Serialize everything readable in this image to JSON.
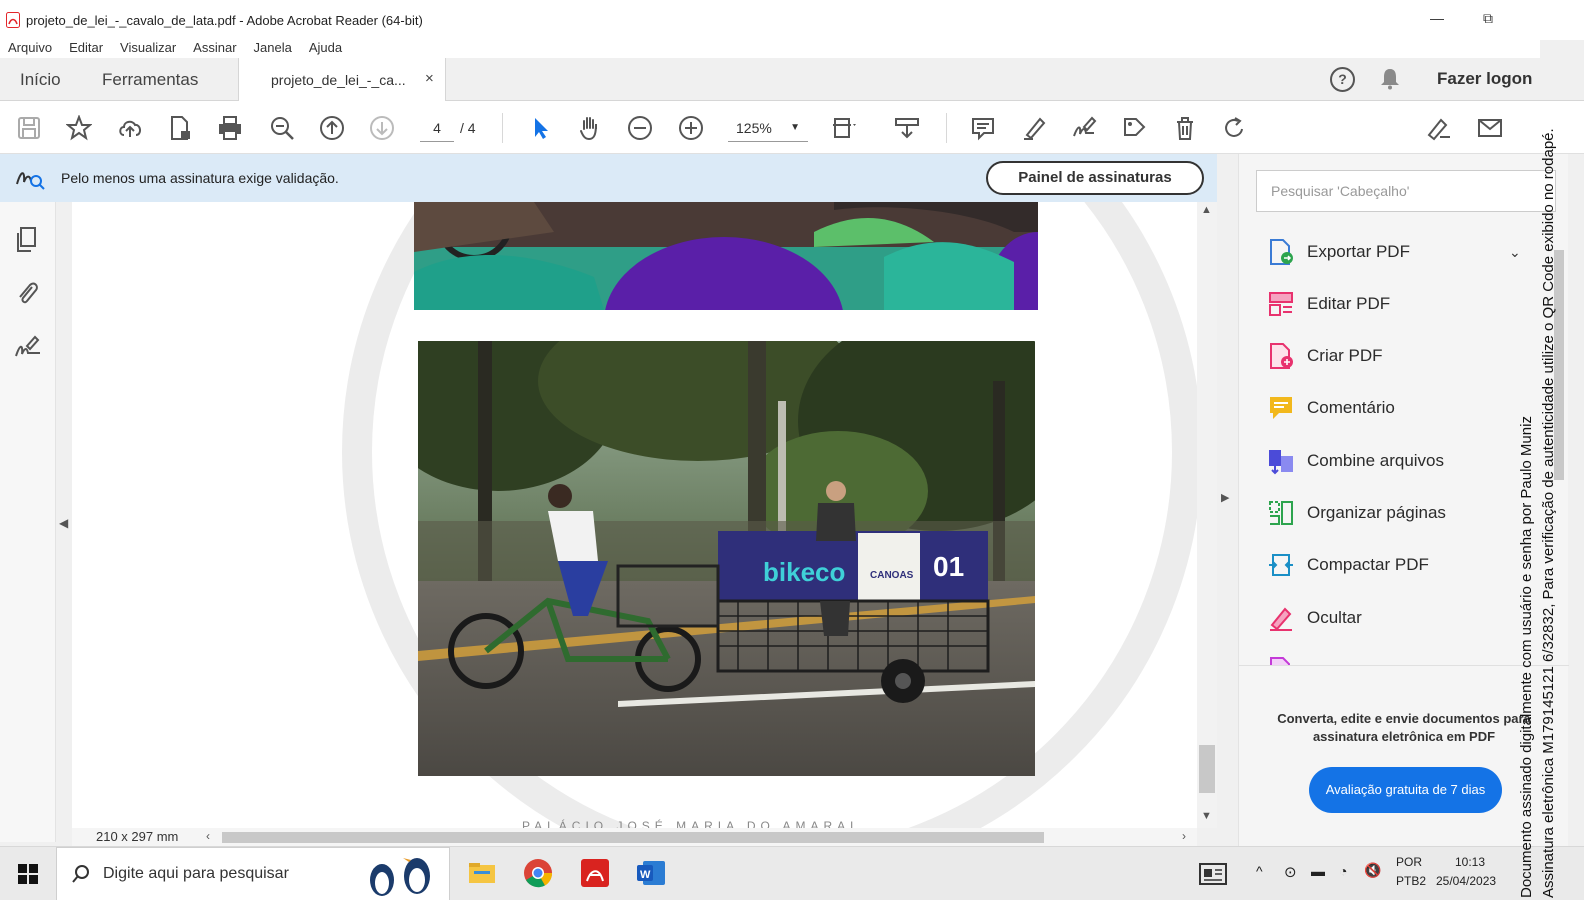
{
  "window": {
    "title": "projeto_de_lei_-_cavalo_de_lata.pdf - Adobe Acrobat Reader (64-bit)",
    "min": "—",
    "restore": "⧉"
  },
  "menu": [
    "Arquivo",
    "Editar",
    "Visualizar",
    "Assinar",
    "Janela",
    "Ajuda"
  ],
  "tabs": {
    "home": "Início",
    "tools": "Ferramentas",
    "doc": "projeto_de_lei_-_ca...",
    "close": "×",
    "logout": "Fazer logon"
  },
  "toolbar": {
    "page_current": "4",
    "page_total": "/ 4",
    "zoom": "125%"
  },
  "signature_bar": {
    "message": "Pelo menos uma assinatura exige validação.",
    "button": "Painel de assinaturas"
  },
  "document": {
    "footer": "PALÁCIO JOSÉ MARIA DO AMARAL",
    "size": "210 x 297 mm",
    "banner_text": "bikeco",
    "banner_city": "CANOAS",
    "banner_number": "01"
  },
  "right_panel": {
    "search_placeholder": "Pesquisar 'Cabeçalho'",
    "tools": [
      {
        "label": "Exportar PDF",
        "icon": "export-pdf-icon",
        "color": "#3a7bd5"
      },
      {
        "label": "Editar PDF",
        "icon": "edit-pdf-icon",
        "color": "#e8326e"
      },
      {
        "label": "Criar PDF",
        "icon": "create-pdf-icon",
        "color": "#e8326e"
      },
      {
        "label": "Comentário",
        "icon": "comment-icon",
        "color": "#f2b81c"
      },
      {
        "label": "Combine arquivos",
        "icon": "combine-icon",
        "color": "#4b4bd8"
      },
      {
        "label": "Organizar páginas",
        "icon": "organize-icon",
        "color": "#2da44e"
      },
      {
        "label": "Compactar PDF",
        "icon": "compress-icon",
        "color": "#1a8fc6"
      },
      {
        "label": "Ocultar",
        "icon": "redact-icon",
        "color": "#e8326e"
      }
    ],
    "promo": "Converta, edite e envie documentos para assinatura eletrônica em PDF",
    "trial_button": "Avaliação gratuita de 7 dias"
  },
  "taskbar": {
    "search_placeholder": "Digite aqui para pesquisar",
    "lang1": "POR",
    "lang2": "PTB2",
    "time": "10:13",
    "date": "25/04/2023"
  },
  "stamp": {
    "line1": "Documento assinado digitalmente com usuário e senha por Paulo Muniz",
    "line2": "Assinatura eletrônica M179145121 6/32832, Para verificação de autenticidade utilize o QR Code exibido no rodapé."
  }
}
